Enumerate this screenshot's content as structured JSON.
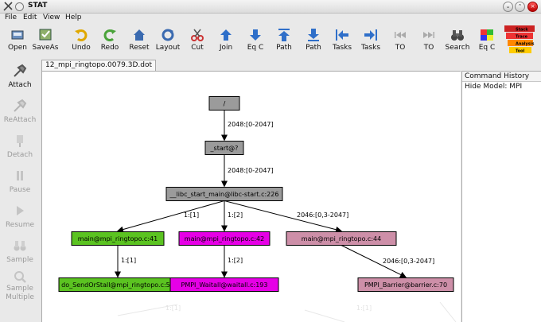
{
  "window": {
    "title": "STAT",
    "buttons": {
      "minimize": "⌄",
      "maximize": "⌃",
      "close": "×"
    }
  },
  "menu": [
    "File",
    "Edit",
    "View",
    "Help"
  ],
  "toolbar": [
    {
      "label": "Open",
      "icon": "open-icon"
    },
    {
      "label": "SaveAs",
      "icon": "saveas-icon"
    },
    {
      "label": "Undo",
      "icon": "undo-icon"
    },
    {
      "label": "Redo",
      "icon": "redo-icon"
    },
    {
      "label": "Reset",
      "icon": "reset-icon"
    },
    {
      "label": "Layout",
      "icon": "layout-icon"
    },
    {
      "label": "Cut",
      "icon": "scissors-icon"
    },
    {
      "label": "Join",
      "icon": "arrow-up-icon"
    },
    {
      "label": "Eq C",
      "icon": "arrow-down-icon"
    },
    {
      "label": "Path",
      "icon": "arrow-up-bar-icon"
    },
    {
      "label": "Path",
      "icon": "arrow-down-bar-icon"
    },
    {
      "label": "Tasks",
      "icon": "arrow-left-bar-icon"
    },
    {
      "label": "Tasks",
      "icon": "arrow-right-bar-icon"
    },
    {
      "label": "TO",
      "icon": "rewind-icon"
    },
    {
      "label": "TO",
      "icon": "fast-forward-icon"
    },
    {
      "label": "Search",
      "icon": "binoculars-icon"
    },
    {
      "label": "Eq C",
      "icon": "color-squares-icon"
    }
  ],
  "logo": [
    "Stack",
    "Trace",
    "Analysis",
    "Tool"
  ],
  "sidebar": [
    {
      "label": "Attach",
      "enabled": true
    },
    {
      "label": "ReAttach",
      "enabled": false
    },
    {
      "label": "Detach",
      "enabled": false
    },
    {
      "label": "Pause",
      "enabled": false
    },
    {
      "label": "Resume",
      "enabled": false
    },
    {
      "label": "Sample",
      "enabled": false
    },
    {
      "label": "Sample Multiple",
      "enabled": false
    }
  ],
  "tab": "12_mpi_ringtopo.0079.3D.dot",
  "history": {
    "header": "Command History",
    "items": [
      "Hide Model: MPI"
    ]
  },
  "graph": {
    "nodes": [
      {
        "id": "root",
        "label": "/",
        "fill": "#9b9b9b"
      },
      {
        "id": "start",
        "label": "_start@?",
        "fill": "#9b9b9b"
      },
      {
        "id": "libc",
        "label": "__libc_start_main@libc-start.c:226",
        "fill": "#9b9b9b"
      },
      {
        "id": "main1",
        "label": "main@mpi_ringtopo.c:41",
        "fill": "#5bc321"
      },
      {
        "id": "main2",
        "label": "main@mpi_ringtopo.c:42",
        "fill": "#e600e6"
      },
      {
        "id": "main3",
        "label": "main@mpi_ringtopo.c:44",
        "fill": "#cd8fa8"
      },
      {
        "id": "leaf1",
        "label": "do_SendOrStall@mpi_ringtopo.c:58",
        "fill": "#5bc321"
      },
      {
        "id": "leaf2",
        "label": "PMPI_Waitall@waitall.c:193",
        "fill": "#e600e6"
      },
      {
        "id": "leaf3",
        "label": "PMPI_Barrier@barrier.c:70",
        "fill": "#cd8fa8"
      }
    ],
    "edges": [
      {
        "from": "root",
        "to": "start",
        "label": "2048:[0-2047]"
      },
      {
        "from": "start",
        "to": "libc",
        "label": "2048:[0-2047]"
      },
      {
        "from": "libc",
        "to": "main1",
        "label": "1:[1]"
      },
      {
        "from": "libc",
        "to": "main2",
        "label": "1:[2]"
      },
      {
        "from": "libc",
        "to": "main3",
        "label": "2046:[0,3-2047]"
      },
      {
        "from": "main1",
        "to": "leaf1",
        "label": "1:[1]"
      },
      {
        "from": "main2",
        "to": "leaf2",
        "label": "1:[2]"
      },
      {
        "from": "main3",
        "to": "leaf3",
        "label": "2046:[0,3-2047]"
      }
    ]
  }
}
